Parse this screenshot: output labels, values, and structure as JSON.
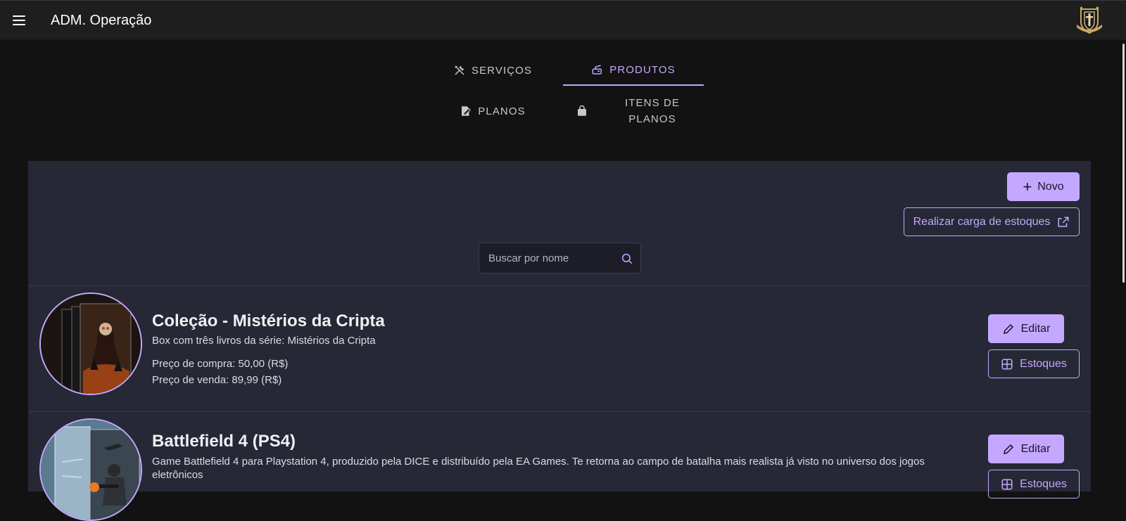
{
  "topbar": {
    "title": "ADM. Operação",
    "menu_icon": "hamburger-menu-icon",
    "logo_icon": "shield-crest-logo"
  },
  "tabs": [
    {
      "label": "SERVIÇOS",
      "icon": "tools-icon",
      "active": false
    },
    {
      "label": "PRODUTOS",
      "icon": "product-box-icon",
      "active": true
    },
    {
      "label": "PLANOS",
      "icon": "edit-document-icon",
      "active": false
    },
    {
      "label": "ITENS DE PLANOS",
      "icon": "shopping-bag-icon",
      "active": false
    }
  ],
  "toolbar": {
    "new_label": "Novo",
    "load_stock_label": "Realizar carga de estoques",
    "search_placeholder": "Buscar por nome"
  },
  "products": [
    {
      "name": "Coleção - Mistérios da Cripta",
      "description": "Box com três livros da série: Mistérios da Cripta",
      "purchase_price": "Preço de compra: 50,00 (R$)",
      "sale_price": "Preço de venda: 89,99 (R$)",
      "edit_label": "Editar",
      "stock_label": "Estoques"
    },
    {
      "name": "Battlefield 4 (PS4)",
      "description": "Game Battlefield 4 para Playstation 4, produzido pela DICE e distribuído pela EA Games. Te retorna ao campo de batalha mais realista já visto no universo dos jogos eletrônicos",
      "edit_label": "Editar",
      "stock_label": "Estoques"
    }
  ],
  "colors": {
    "accent": "#c4a8ff",
    "background": "#121212",
    "panel": "#262835",
    "topbar": "#1e1e1e"
  }
}
